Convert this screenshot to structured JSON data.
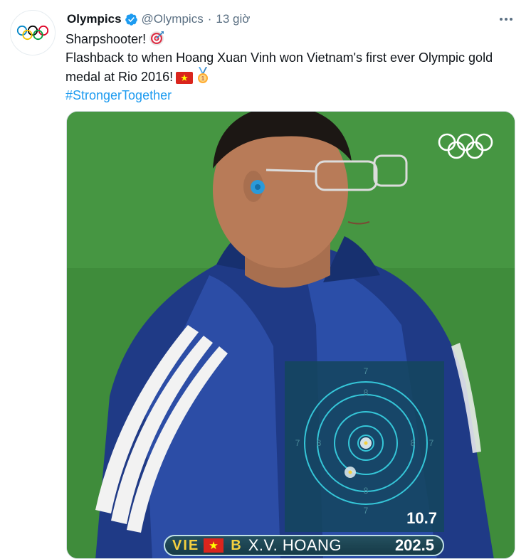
{
  "tweet": {
    "author_name": "Olympics",
    "author_handle": "@Olympics",
    "time": "13 giờ",
    "line1": "Sharpshooter!",
    "line2": "Flashback to when Hoang Xuan Vinh won Vietnam's first ever Olympic gold medal at Rio 2016!",
    "hashtag": "#StrongerTogether"
  },
  "media": {
    "target_score": "10.7",
    "scoreboard": {
      "country": "VIE",
      "relay": "B",
      "athlete": "X.V. HOANG",
      "total": "202.5"
    },
    "target_ring_numbers": [
      "7",
      "8",
      "7",
      "8",
      "8",
      "7",
      "8",
      "7"
    ]
  },
  "icons": {
    "avatar": "olympic-rings-icon",
    "verified": "verified-badge-icon",
    "more": "more-options-icon",
    "target_emoji": "direct-hit-target-icon",
    "flag_emoji": "vietnam-flag-icon",
    "medal_emoji": "gold-medal-icon"
  },
  "colors": {
    "link": "#1d9bf0",
    "muted": "#5b7083",
    "verified": "#1d9bf0",
    "flag_red": "#da251d",
    "flag_star": "#ffff00"
  }
}
